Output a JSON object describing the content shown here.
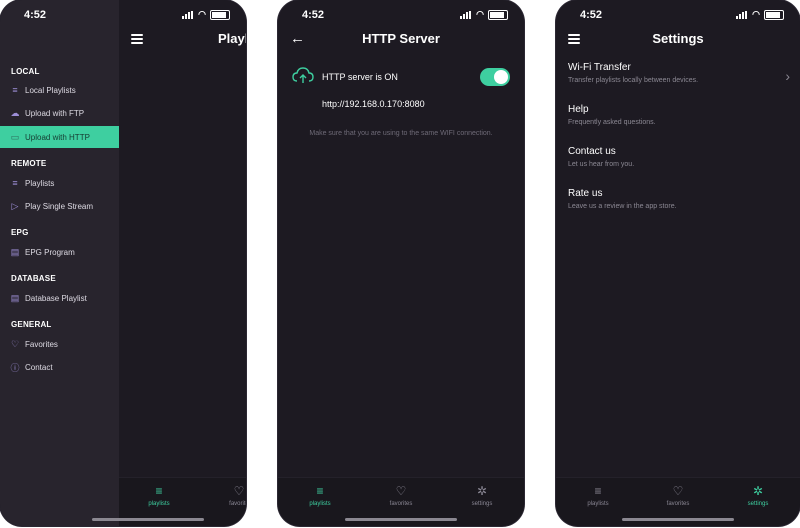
{
  "status_time": "4:52",
  "colors": {
    "accent": "#3ecfa0",
    "background": "#1d1a22",
    "drawer": "#28242d",
    "icon_purple": "#9e8fd8"
  },
  "screen1": {
    "header_title_partial": "Playl",
    "sections": {
      "local": "LOCAL",
      "remote": "REMOTE",
      "epg": "EPG",
      "database": "DATABASE",
      "general": "GENERAL"
    },
    "items": {
      "local_playlists": "Local Playlists",
      "upload_ftp": "Upload with FTP",
      "upload_http": "Upload with HTTP",
      "playlists": "Playlists",
      "play_single_stream": "Play Single Stream",
      "epg_program": "EPG Program",
      "database_playlist": "Database Playlist",
      "favorites": "Favorites",
      "contact": "Contact"
    },
    "tabs": {
      "playlists": "playlists",
      "favorites_partial": "favorite"
    }
  },
  "screen2": {
    "title": "HTTP Server",
    "server_status": "HTTP server is ON",
    "toggle_on": true,
    "url": "http://192.168.0.170:8080",
    "hint": "Make sure that you are using to the same WIFI connection.",
    "tabs": {
      "playlists": "playlists",
      "favorites": "favorites",
      "settings": "settings"
    }
  },
  "screen3": {
    "title": "Settings",
    "rows": [
      {
        "title": "Wi-Fi Transfer",
        "subtitle": "Transfer playlists locally between devices."
      },
      {
        "title": "Help",
        "subtitle": "Frequently asked questions."
      },
      {
        "title": "Contact us",
        "subtitle": "Let us hear from you."
      },
      {
        "title": "Rate us",
        "subtitle": "Leave us a review in the app store."
      }
    ],
    "tabs": {
      "playlists": "playlists",
      "favorites": "favorites",
      "settings": "settings"
    }
  }
}
